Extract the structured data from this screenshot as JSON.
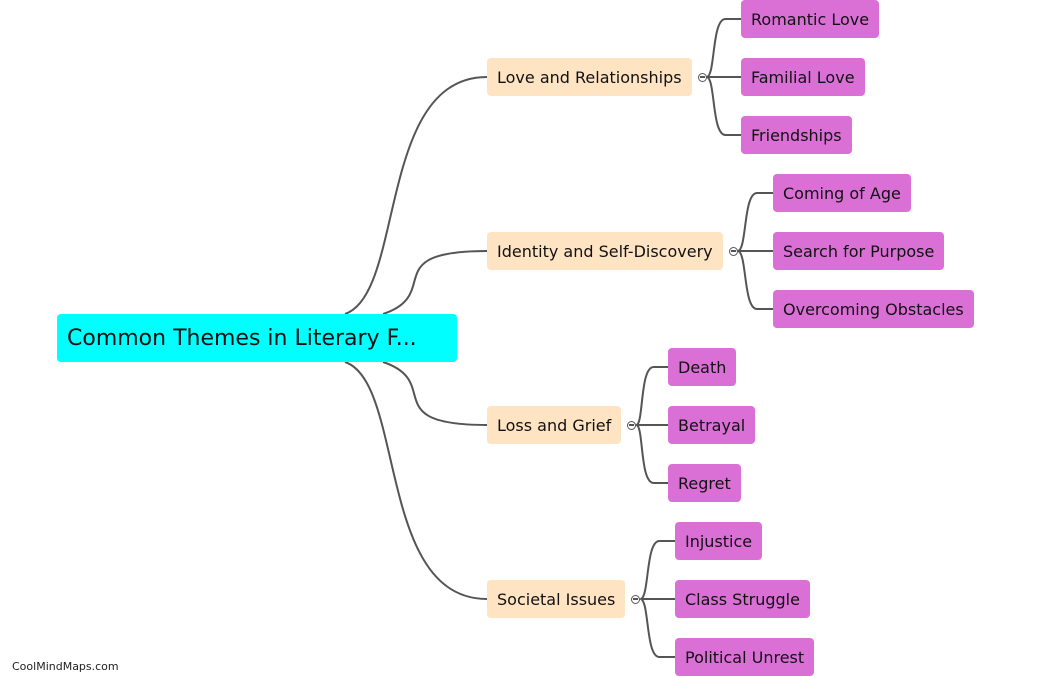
{
  "mindmap": {
    "root": "Common Themes in Literary F...",
    "branches": [
      {
        "label": "Love and Relationships",
        "children": [
          "Romantic Love",
          "Familial Love",
          "Friendships"
        ]
      },
      {
        "label": "Identity and Self-Discovery",
        "children": [
          "Coming of Age",
          "Search for Purpose",
          "Overcoming Obstacles"
        ]
      },
      {
        "label": "Loss and Grief",
        "children": [
          "Death",
          "Betrayal",
          "Regret"
        ]
      },
      {
        "label": "Societal Issues",
        "children": [
          "Injustice",
          "Class Struggle",
          "Political Unrest"
        ]
      }
    ]
  },
  "colors": {
    "root": "#00ffff",
    "branch": "#ffe4c4",
    "leaf": "#da70d6",
    "link": "#555555"
  },
  "watermark": "CoolMindMaps.com"
}
